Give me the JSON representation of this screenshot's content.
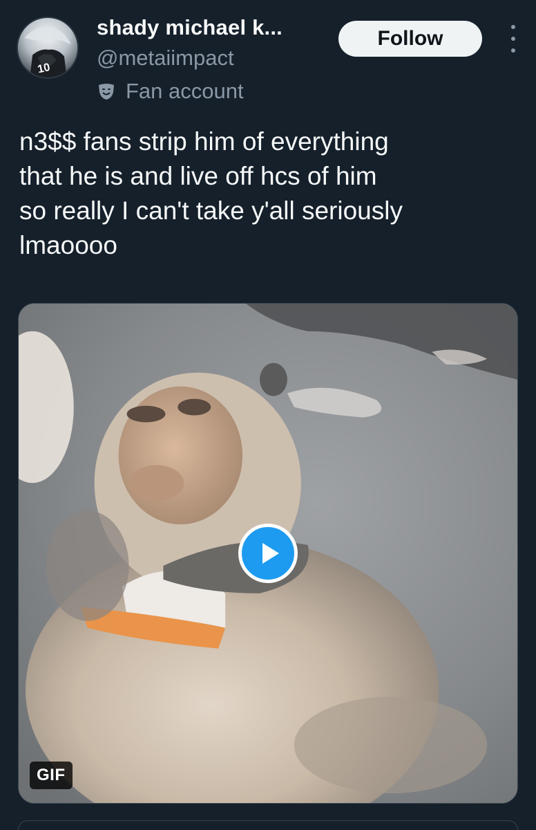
{
  "author": {
    "display_name": "shady michael k...",
    "handle": "@metaiimpact",
    "label_icon": "theater-masks-icon",
    "label_text": "Fan account",
    "avatar_jersey_number": "10"
  },
  "actions": {
    "follow_label": "Follow",
    "more_icon": "vertical-ellipsis-icon"
  },
  "tweet": {
    "text": "n3$$ fans strip him of everything\nthat he is and live off hcs of him\nso really I can't take y'all seriously\nlmaoooo"
  },
  "media": {
    "type": "GIF",
    "badge_label": "GIF",
    "play_icon": "play-icon"
  },
  "colors": {
    "background": "#15202b",
    "primary_text": "#f7f9f9",
    "secondary_text": "#8b98a5",
    "accent": "#1d9bf0",
    "follow_button_bg": "#eff3f4"
  }
}
